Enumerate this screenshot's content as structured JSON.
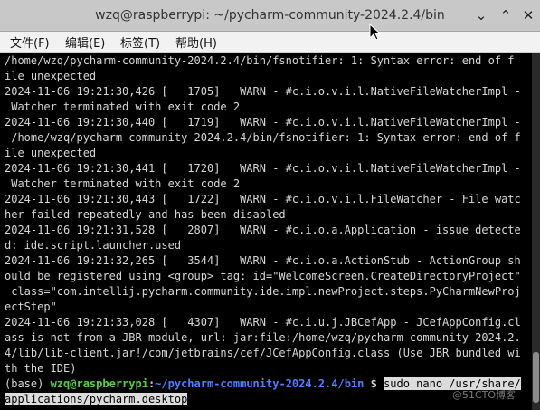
{
  "window": {
    "title": "wzq@raspberrypi: ~/pycharm-community-2024.2.4/bin",
    "minimize_glyph": "⌄",
    "maximize_glyph": "⌃",
    "close_glyph": "✕"
  },
  "menu": [
    {
      "label": "文件(F)"
    },
    {
      "label": "编辑(E)"
    },
    {
      "label": "标签(T)"
    },
    {
      "label": "帮助(H)"
    }
  ],
  "terminal": {
    "lines": [
      "/home/wzq/pycharm-community-2024.2.4/bin/fsnotifier: 1: Syntax error: end of f",
      "ile unexpected",
      "2024-11-06 19:21:30,426 [   1705]   WARN - #c.i.o.v.i.l.NativeFileWatcherImpl -",
      " Watcher terminated with exit code 2",
      "2024-11-06 19:21:30,440 [   1719]   WARN - #c.i.o.v.i.l.NativeFileWatcherImpl -",
      " /home/wzq/pycharm-community-2024.2.4/bin/fsnotifier: 1: Syntax error: end of f",
      "ile unexpected",
      "2024-11-06 19:21:30,441 [   1720]   WARN - #c.i.o.v.i.l.NativeFileWatcherImpl -",
      " Watcher terminated with exit code 2",
      "2024-11-06 19:21:30,443 [   1722]   WARN - #c.i.o.v.i.l.FileWatcher - File watc",
      "her failed repeatedly and has been disabled",
      "2024-11-06 19:21:31,528 [   2807]   WARN - #c.i.o.a.Application - issue detecte",
      "d: ide.script.launcher.used",
      "2024-11-06 19:21:32,265 [   3544]   WARN - #c.i.o.a.ActionStub - ActionGroup sh",
      "ould be registered using <group> tag: id=\"WelcomeScreen.CreateDirectoryProject\"",
      " class=\"com.intellij.pycharm.community.ide.impl.newProject.steps.PyCharmNewProj",
      "ectStep\"",
      "2024-11-06 19:21:33,028 [   4307]   WARN - #c.i.u.j.JBCefApp - JCefAppConfig.cl",
      "ass is not from a JBR module, url: jar:file:/home/wzq/pycharm-community-2024.2.",
      "4/lib/lib-client.jar!/com/jetbrains/cef/JCefAppConfig.class (Use JBR bundled wi",
      "th the IDE)"
    ],
    "prompt": {
      "env": "(base) ",
      "user_host": "wzq@raspberrypi",
      "colon": ":",
      "path": "~/pycharm-community-2024.2.4/bin",
      "symbol": " $ ",
      "command_part1": "sudo nano /usr/share/",
      "command_part2": "applications/pycharm.desktop"
    }
  },
  "watermark": "@51CTO博客",
  "colors": {
    "terminal_bg": "#000000",
    "terminal_fg": "#d6d6d6",
    "prompt_user": "#55d046",
    "prompt_path": "#4d7fff",
    "titlebar_bg": "#c8c8c8",
    "selection_bg": "#dcdcdc"
  }
}
